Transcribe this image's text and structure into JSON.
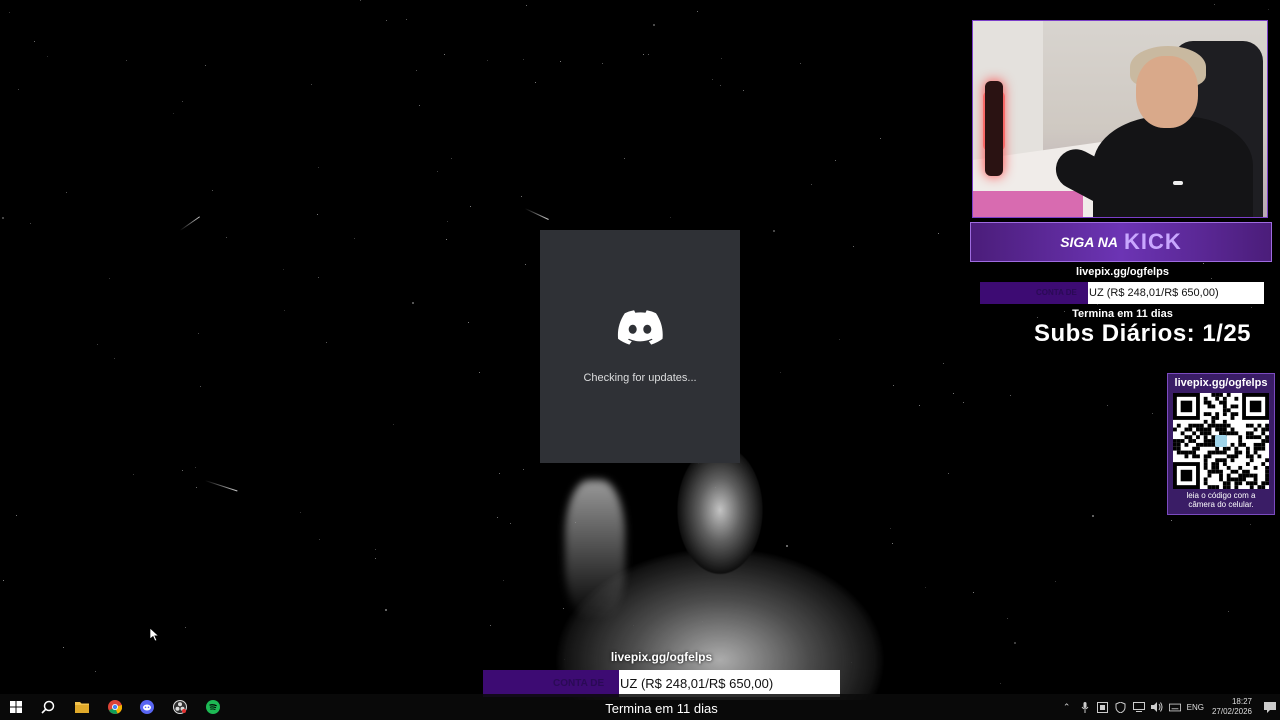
{
  "discord_updater": {
    "status": "Checking for updates..."
  },
  "overlay": {
    "kick_banner": {
      "prefix": "SIGA NA",
      "brand": "KICK"
    },
    "goal_right": {
      "site": "livepix.gg/ogfelps",
      "fill_label": "CONTA DE",
      "progress_text": "UZ (R$ 248,01/R$ 650,00)",
      "progress_fraction": 0.38,
      "deadline": "Termina em 11 dias"
    },
    "subs_daily": "Subs Diários: 1/25",
    "qr": {
      "site": "livepix.gg/ogfelps",
      "caption_line1": "leia o código com a",
      "caption_line2": "câmera do celular."
    },
    "goal_bottom": {
      "site": "livepix.gg/ogfelps",
      "fill_label": "CONTA DE",
      "progress_text": "UZ (R$ 248,01/R$ 650,00)",
      "progress_fraction": 0.38,
      "deadline": "Termina em 11 dias"
    }
  },
  "taskbar": {
    "apps": [
      "start-icon",
      "search-icon",
      "file-explorer-icon",
      "chrome-icon",
      "discord-icon",
      "obs-icon",
      "spotify-icon"
    ],
    "language": "ENG",
    "time": "18:27",
    "date": "27/02/2026"
  },
  "colors": {
    "accent_purple": "#6c34b4",
    "goal_fill": "#3d0b73",
    "discord_bg": "#2f3136",
    "spotify_green": "#1db954"
  }
}
